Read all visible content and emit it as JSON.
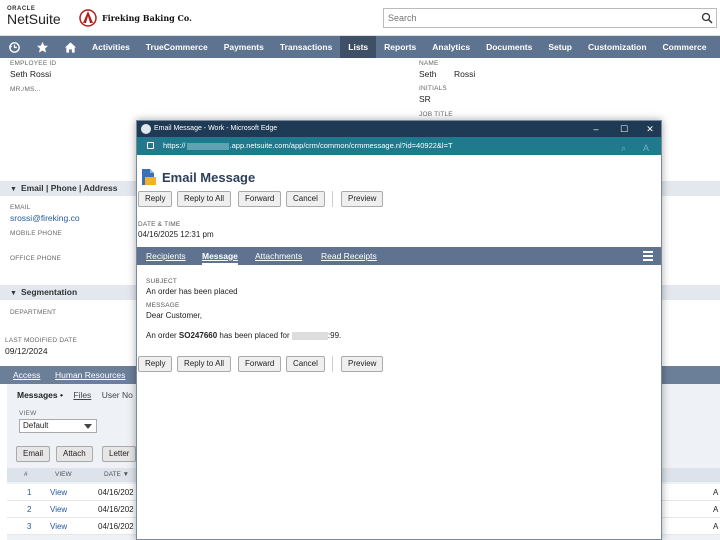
{
  "header": {
    "oracle_label": "ORACLE",
    "brand": "NetSuite",
    "company": "Fireking Baking Co.",
    "search_placeholder": "Search"
  },
  "nav": {
    "items": [
      {
        "label": "Activities",
        "active": false
      },
      {
        "label": "TrueCommerce",
        "active": false
      },
      {
        "label": "Payments",
        "active": false
      },
      {
        "label": "Transactions",
        "active": false
      },
      {
        "label": "Lists",
        "active": true
      },
      {
        "label": "Reports",
        "active": false
      },
      {
        "label": "Analytics",
        "active": false
      },
      {
        "label": "Documents",
        "active": false
      },
      {
        "label": "Setup",
        "active": false
      },
      {
        "label": "Customization",
        "active": false
      },
      {
        "label": "Commerce",
        "active": false
      }
    ]
  },
  "record": {
    "employee_id_label": "EMPLOYEE ID",
    "employee_id_value": "Seth Rossi",
    "mr_ms_label": "MR./MS...",
    "name_label": "NAME",
    "first_name": "Seth",
    "last_name": "Rossi",
    "initials_label": "INITIALS",
    "initials_value": "SR",
    "job_title_label": "JOB TITLE",
    "email_section": "Email | Phone | Address",
    "email_label": "EMAIL",
    "email_value": "srossi@fireking.co",
    "mobile_label": "MOBILE PHONE",
    "office_label": "OFFICE PHONE",
    "segmentation_section": "Segmentation",
    "department_label": "DEPARTMENT",
    "last_modified_label": "LAST MODIFIED DATE",
    "last_modified_value": "09/12/2024",
    "subtabs": [
      "Access",
      "Human Resources"
    ],
    "messages_tab": "Messages",
    "files_tab": "Files",
    "user_notes_tab": "User No",
    "view_label": "VIEW",
    "view_value": "Default",
    "buttons": [
      "Email",
      "Attach",
      "Letter"
    ],
    "table_headers": [
      "#",
      "VIEW",
      "DATE ▼"
    ],
    "rows": [
      {
        "num": "1",
        "view": "View",
        "date": "04/16/202",
        "tail": "A"
      },
      {
        "num": "2",
        "view": "View",
        "date": "04/16/202",
        "tail": "A"
      },
      {
        "num": "3",
        "view": "View",
        "date": "04/16/202",
        "tail": "A"
      }
    ]
  },
  "modal": {
    "window_title": "Email Message - Work - Microsoft Edge",
    "url_prefix": "https://",
    "url_suffix": ".app.netsuite.com/app/crm/common/crmmessage.nl?id=40922&l=T",
    "title": "Email Message",
    "buttons": {
      "reply": "Reply",
      "reply_all": "Reply to All",
      "forward": "Forward",
      "cancel": "Cancel",
      "preview": "Preview"
    },
    "date_label": "DATE & TIME",
    "date_value": "04/16/2025 12:31 pm",
    "tabs": [
      {
        "label": "Recipients",
        "active": false
      },
      {
        "label": "Message",
        "active": true
      },
      {
        "label": "Attachments",
        "active": false
      },
      {
        "label": "Read Receipts",
        "active": false
      }
    ],
    "subject_label": "SUBJECT",
    "subject_value": "An order has been placed",
    "message_label": "MESSAGE",
    "greeting": "Dear Customer,",
    "body_prefix": "An order ",
    "order_number": "SO247660",
    "body_middle": " has been placed for ",
    "body_suffix": ":99."
  },
  "colors": {
    "nav_bg": "#5e738f",
    "nav_active": "#3f4f66",
    "window_title_bg": "#1f3a54",
    "address_bar_bg": "#1e7a8c",
    "link": "#255a9b"
  }
}
